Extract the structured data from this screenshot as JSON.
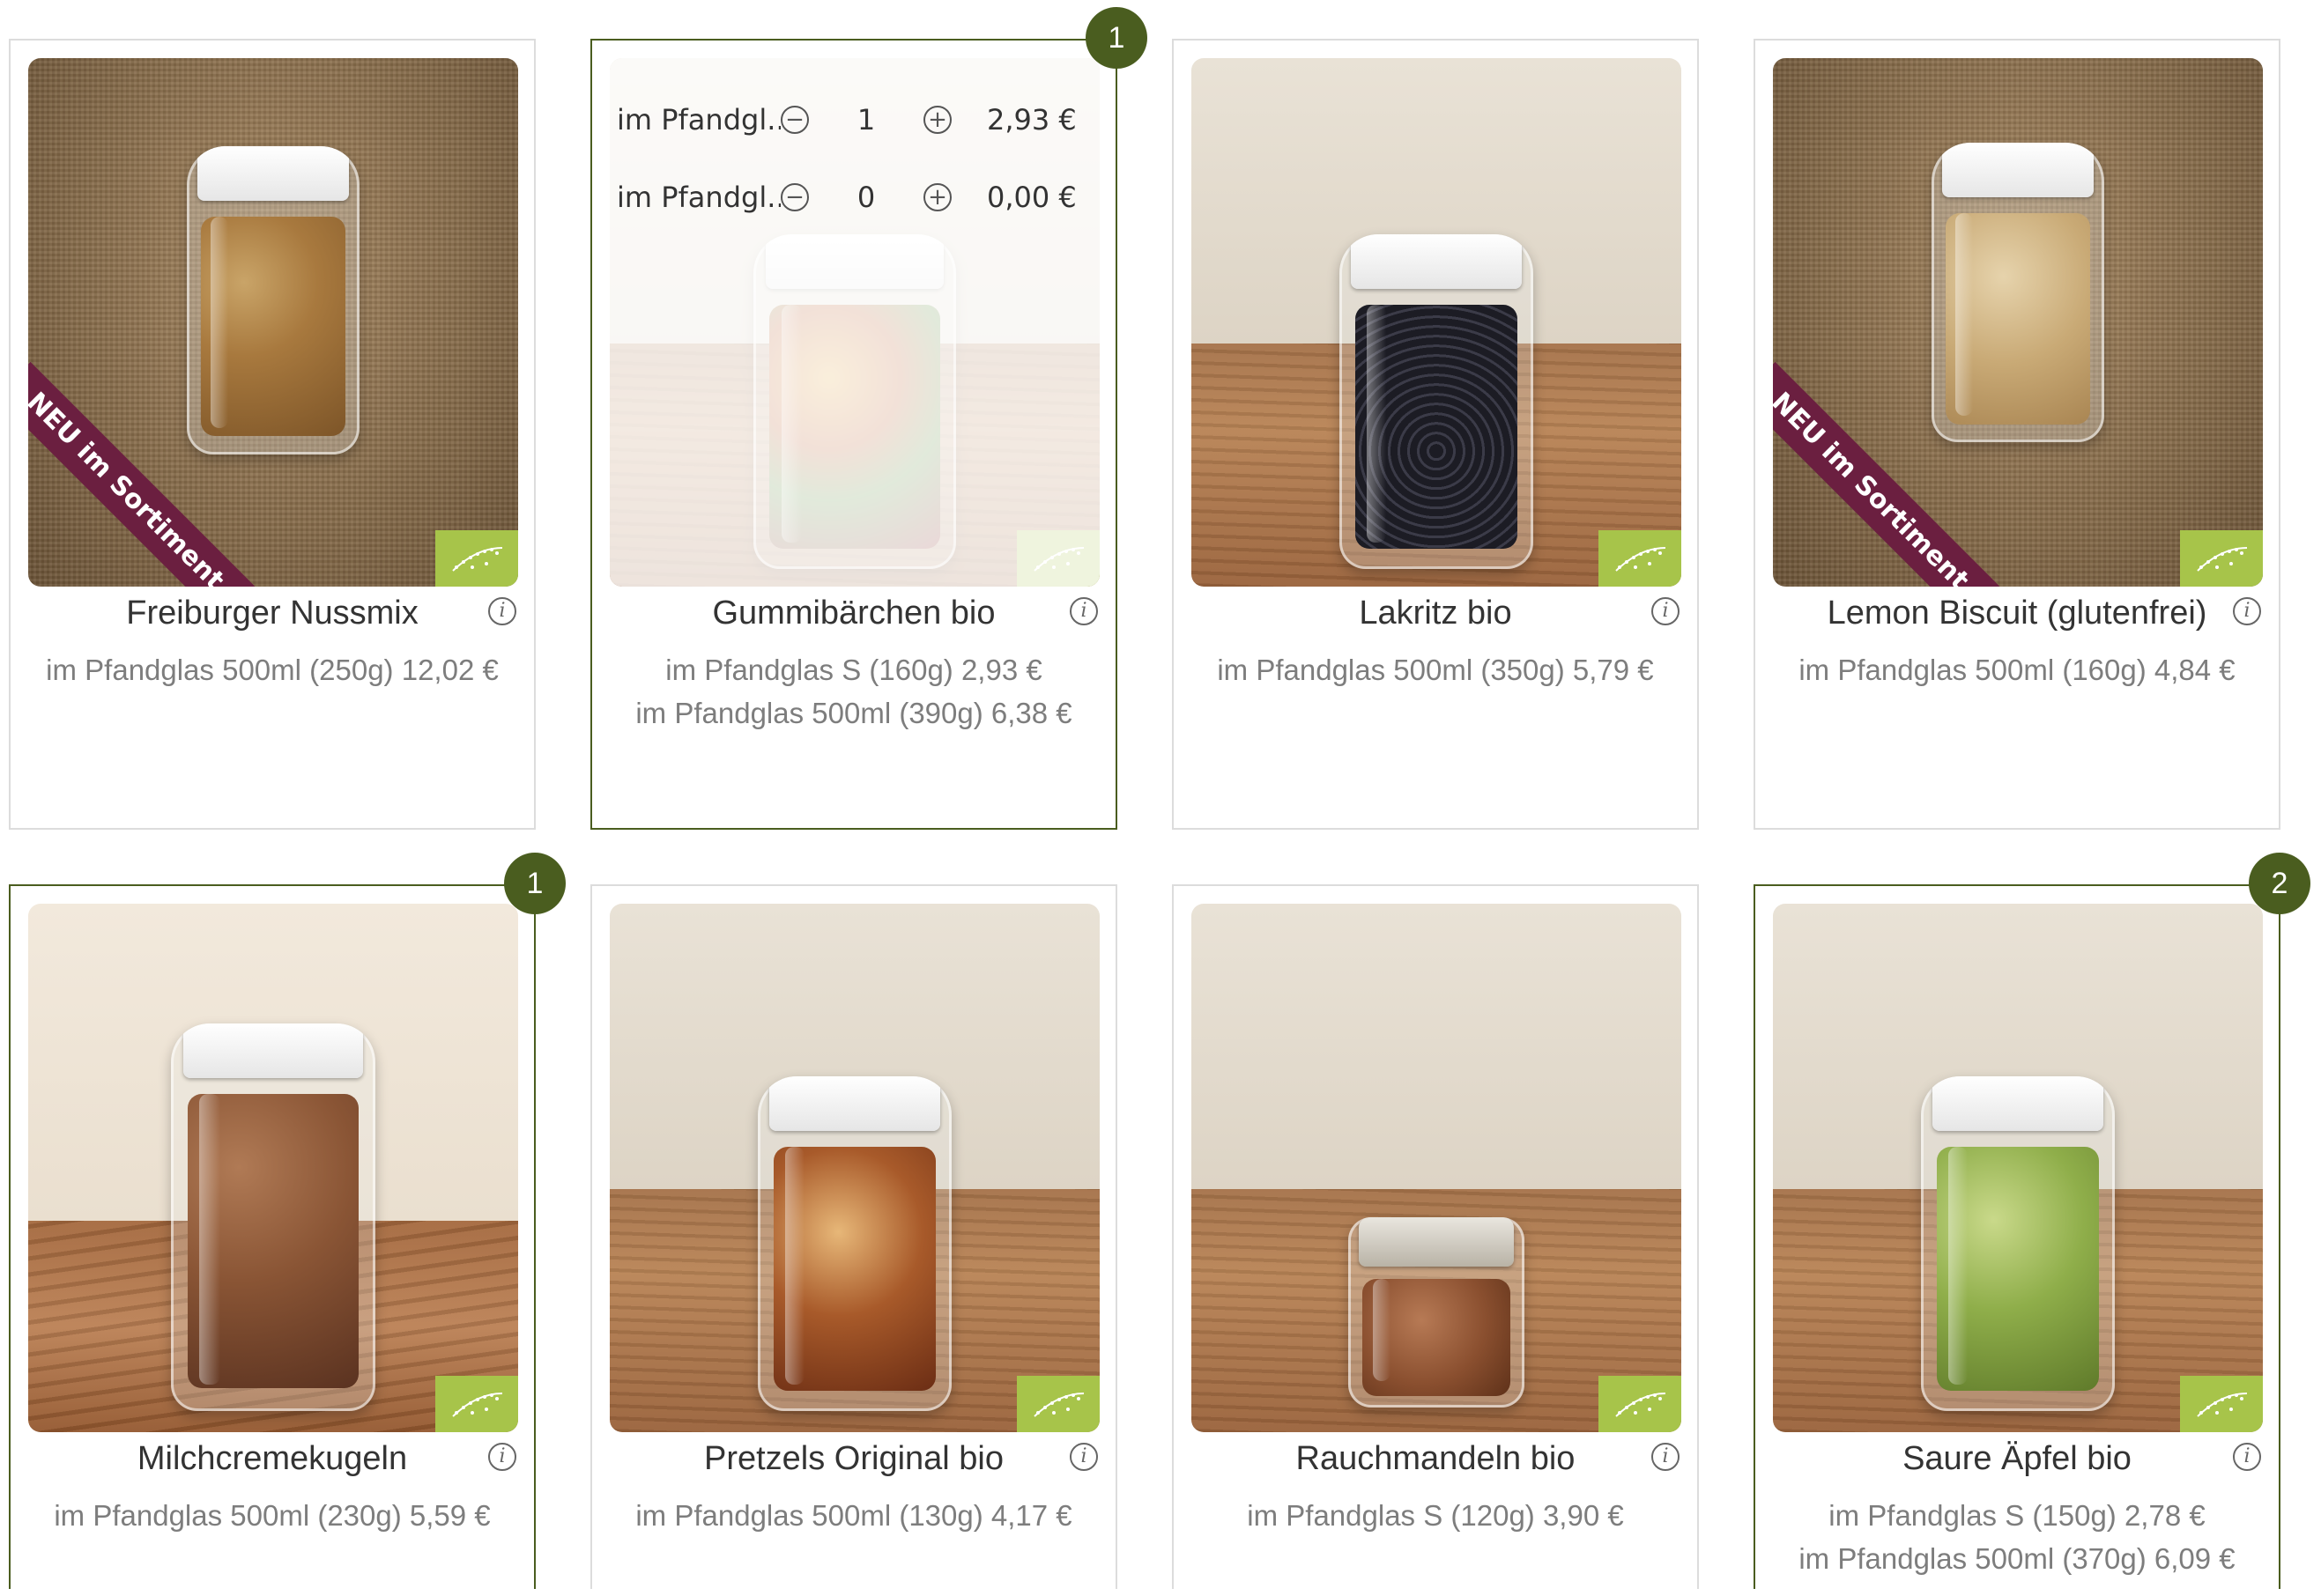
{
  "products": [
    {
      "name": "Freiburger Nussmix",
      "variants": [
        "im Pfandglas 500ml (250g) 12,02 €"
      ],
      "ribbon": "NEU im Sortiment",
      "badge_count": null
    },
    {
      "name": "Gummibärchen bio",
      "variants": [
        "im Pfandglas S (160g) 2,93 €",
        "im Pfandglas 500ml (390g) 6,38 €"
      ],
      "ribbon": null,
      "badge_count": "1",
      "quantity_overlay": [
        {
          "label": "im Pfandgl...",
          "qty": "1",
          "price": "2,93 €"
        },
        {
          "label": "im Pfandgl...",
          "qty": "0",
          "price": "0,00 €"
        }
      ]
    },
    {
      "name": "Lakritz bio",
      "variants": [
        "im Pfandglas 500ml (350g) 5,79 €"
      ],
      "ribbon": null,
      "badge_count": null
    },
    {
      "name": "Lemon Biscuit (glutenfrei)",
      "variants": [
        "im Pfandglas 500ml (160g) 4,84 €"
      ],
      "ribbon": "NEU im Sortiment",
      "badge_count": null
    },
    {
      "name": "Milchcremekugeln",
      "variants": [
        "im Pfandglas 500ml (230g) 5,59 €"
      ],
      "ribbon": null,
      "badge_count": "1"
    },
    {
      "name": "Pretzels Original bio",
      "variants": [
        "im Pfandglas 500ml (130g) 4,17 €"
      ],
      "ribbon": null,
      "badge_count": null
    },
    {
      "name": "Rauchmandeln bio",
      "variants": [
        "im Pfandglas S (120g) 3,90 €"
      ],
      "ribbon": null,
      "badge_count": null
    },
    {
      "name": "Saure Äpfel bio",
      "variants": [
        "im Pfandglas S (150g) 2,78 €",
        "im Pfandglas 500ml (370g) 6,09 €"
      ],
      "ribbon": null,
      "badge_count": "2"
    }
  ],
  "icons": {
    "info": "info-icon",
    "minus": "minus-circle-icon",
    "plus": "plus-circle-icon",
    "eu_organic": "eu-organic-leaf-icon"
  },
  "colors": {
    "accent": "#4a5d1f",
    "ribbon": "#6b1f40",
    "organic_badge": "#a7c44a",
    "price_text": "#7d7d7d"
  }
}
